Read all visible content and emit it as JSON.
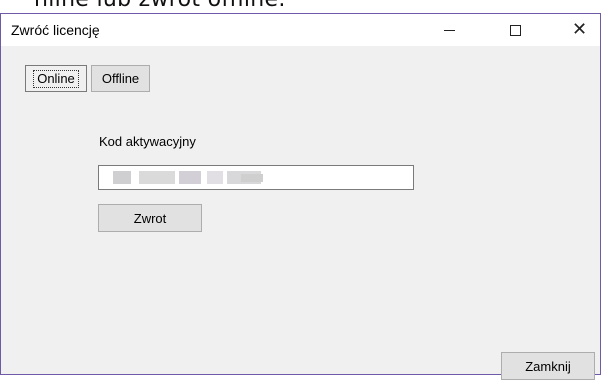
{
  "page_strip_text": "nline lub zwrot offline.",
  "window": {
    "title": "Zwróć licencję",
    "controls": {
      "minimize_icon": "minimize-icon",
      "maximize_icon": "maximize-icon",
      "close_icon": "close-icon",
      "close_glyph": "✕"
    }
  },
  "tabs": {
    "online": "Online",
    "offline": "Offline"
  },
  "form": {
    "code_label": "Kod aktywacyjny",
    "code_value": "",
    "return_button": "Zwrot"
  },
  "footer": {
    "close_button": "Zamknij"
  },
  "colors": {
    "window_border": "#6f5aa8",
    "dialog_bg": "#f0f0f0",
    "button_bg": "#e1e1e1"
  }
}
